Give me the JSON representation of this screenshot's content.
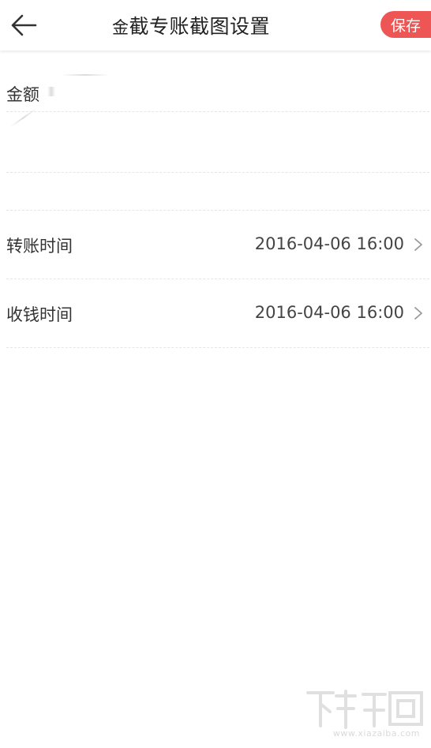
{
  "header": {
    "title_prefix": "金",
    "title": "截专账截图设置",
    "save_label": "保存",
    "back_icon": "arrow-left-icon"
  },
  "fields": {
    "amount_label": "金额",
    "transfer_time_label": "转账时间",
    "transfer_time_value": "2016-04-06 16:00",
    "receive_time_label": "收钱时间",
    "receive_time_value": "2016-04-06 16:00"
  },
  "watermark": {
    "text": "www.xiazaiba.com"
  },
  "colors": {
    "accent": "#ee5555",
    "divider": "#e6e6e6"
  }
}
